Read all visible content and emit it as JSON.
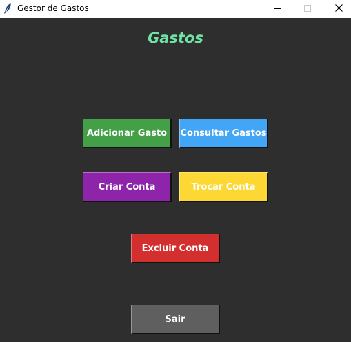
{
  "window": {
    "title": "Gestor de Gastos",
    "app_icon": "feather-icon",
    "controls": {
      "minimize_icon": "minimize-icon",
      "maximize_icon": "maximize-icon",
      "close_icon": "close-icon"
    }
  },
  "main": {
    "heading": "Gastos",
    "heading_color": "#6fe3a3",
    "background": "#2e2e2e",
    "buttons": {
      "add_expense": {
        "label": "Adicionar Gasto",
        "color": "#43a047"
      },
      "view_expenses": {
        "label": "Consultar Gastos",
        "color": "#42a5f5"
      },
      "create_account": {
        "label": "Criar Conta",
        "color": "#8e24aa"
      },
      "switch_account": {
        "label": "Trocar Conta",
        "color": "#fdd835"
      },
      "delete_account": {
        "label": "Excluir Conta",
        "color": "#d32f2f"
      },
      "exit": {
        "label": "Sair",
        "color": "#5f5f5f"
      }
    }
  }
}
